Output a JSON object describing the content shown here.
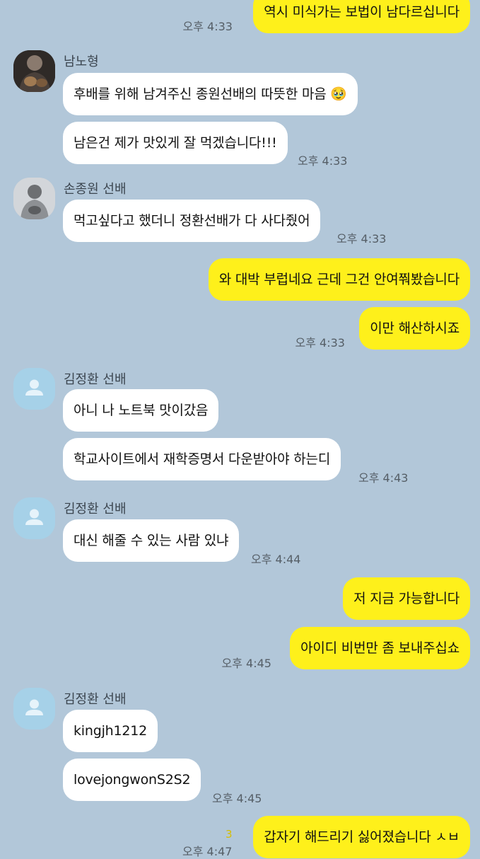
{
  "senders": {
    "nam": "남노형",
    "son": "손종원 선배",
    "kim": "김정환 선배"
  },
  "messages": {
    "m1": {
      "text": "역시 미식가는 보법이 남다르십니다",
      "time": "오후 4:33"
    },
    "m2": {
      "text": "후배를 위해 남겨주신 종원선배의 따뜻한 마음 🥹"
    },
    "m3": {
      "text": "남은건 제가 맛있게 잘 먹겠습니다!!!",
      "time": "오후 4:33"
    },
    "m4": {
      "text": "먹고싶다고 했더니 정환선배가 다 사다줬어",
      "time": "오후 4:33"
    },
    "m5": {
      "text": "와 대박 부럽네요 근데 그건 안여쭤봤습니다"
    },
    "m6": {
      "text": "이만 해산하시죠",
      "time": "오후 4:33"
    },
    "m7": {
      "text": "아니 나 노트북 맛이갔음"
    },
    "m8": {
      "text": "학교사이트에서 재학증명서 다운받아야 하는디",
      "time": "오후 4:43"
    },
    "m9": {
      "text": "대신 해줄 수 있는 사람 있냐",
      "time": "오후 4:44"
    },
    "m10": {
      "text": "저 지금 가능합니다"
    },
    "m11": {
      "text": "아이디 비번만 좀 보내주십쇼",
      "time": "오후 4:45"
    },
    "m12": {
      "text": "kingjh1212"
    },
    "m13": {
      "text": "lovejongwonS2S2",
      "time": "오후 4:45"
    },
    "m14": {
      "text": "갑자기 해드리기 싫어졌습니다 ㅅㅂ",
      "time": "오후 4:47",
      "unread": "3"
    }
  },
  "icons": {
    "default_avatar": "person-silhouette-icon"
  },
  "colors": {
    "background": "#b2c7d9",
    "my_bubble": "#fef01b",
    "their_bubble": "#ffffff",
    "unread_count": "#d6be00"
  }
}
